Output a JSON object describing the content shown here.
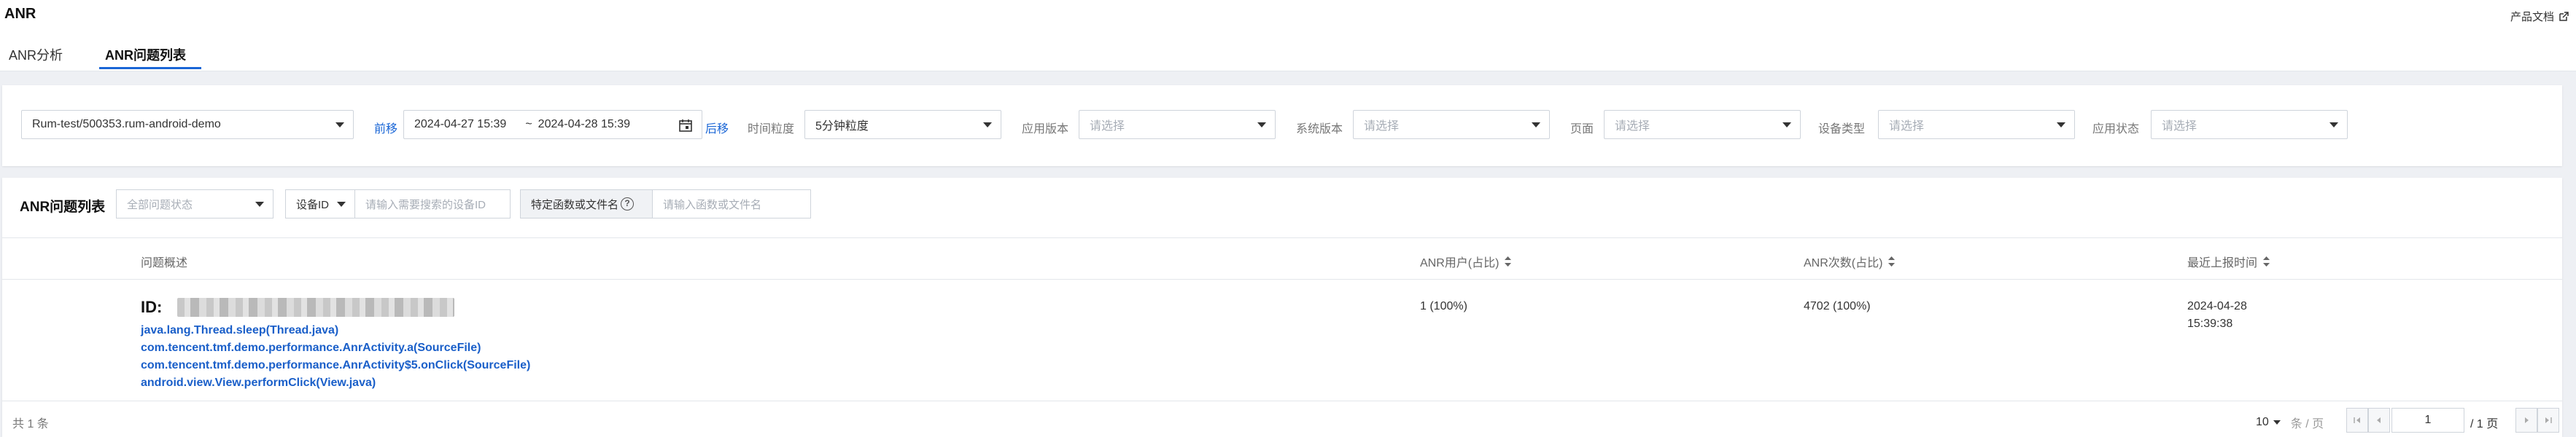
{
  "header": {
    "title": "ANR",
    "doc_link": "产品文档",
    "tabs": [
      {
        "label": "ANR分析"
      },
      {
        "label": "ANR问题列表"
      }
    ]
  },
  "filters": {
    "app": "Rum-test/500353.rum-android-demo",
    "prev": "前移",
    "next": "后移",
    "date_start": "2024-04-27 15:39",
    "date_sep": "~",
    "date_end": "2024-04-28 15:39",
    "granularity_label": "时间粒度",
    "granularity_value": "5分钟粒度",
    "app_version_label": "应用版本",
    "system_version_label": "系统版本",
    "page_label": "页面",
    "device_type_label": "设备类型",
    "app_state_label": "应用状态",
    "placeholder": "请选择"
  },
  "list": {
    "title": "ANR问题列表",
    "status_placeholder": "全部问题状态",
    "device_select": "设备ID",
    "device_placeholder": "请输入需要搜索的设备ID",
    "func_label": "特定函数或文件名",
    "func_placeholder": "请输入函数或文件名",
    "columns": [
      {
        "label": "问题概述"
      },
      {
        "label": "ANR用户(占比)"
      },
      {
        "label": "ANR次数(占比)"
      },
      {
        "label": "最近上报时间"
      }
    ],
    "rows": [
      {
        "id_label": "ID:",
        "stack": [
          "java.lang.Thread.sleep(Thread.java)",
          "com.tencent.tmf.demo.performance.AnrActivity.a(SourceFile)",
          "com.tencent.tmf.demo.performance.AnrActivity$5.onClick(SourceFile)",
          "android.view.View.performClick(View.java)"
        ],
        "users": "1 (100%)",
        "count": "4702 (100%)",
        "date": "2024-04-28",
        "time": "15:39:38"
      }
    ],
    "total": "共 1 条",
    "page_size": "10",
    "page_unit": "条 / 页",
    "page_current": "1",
    "page_total": "/ 1 页"
  }
}
